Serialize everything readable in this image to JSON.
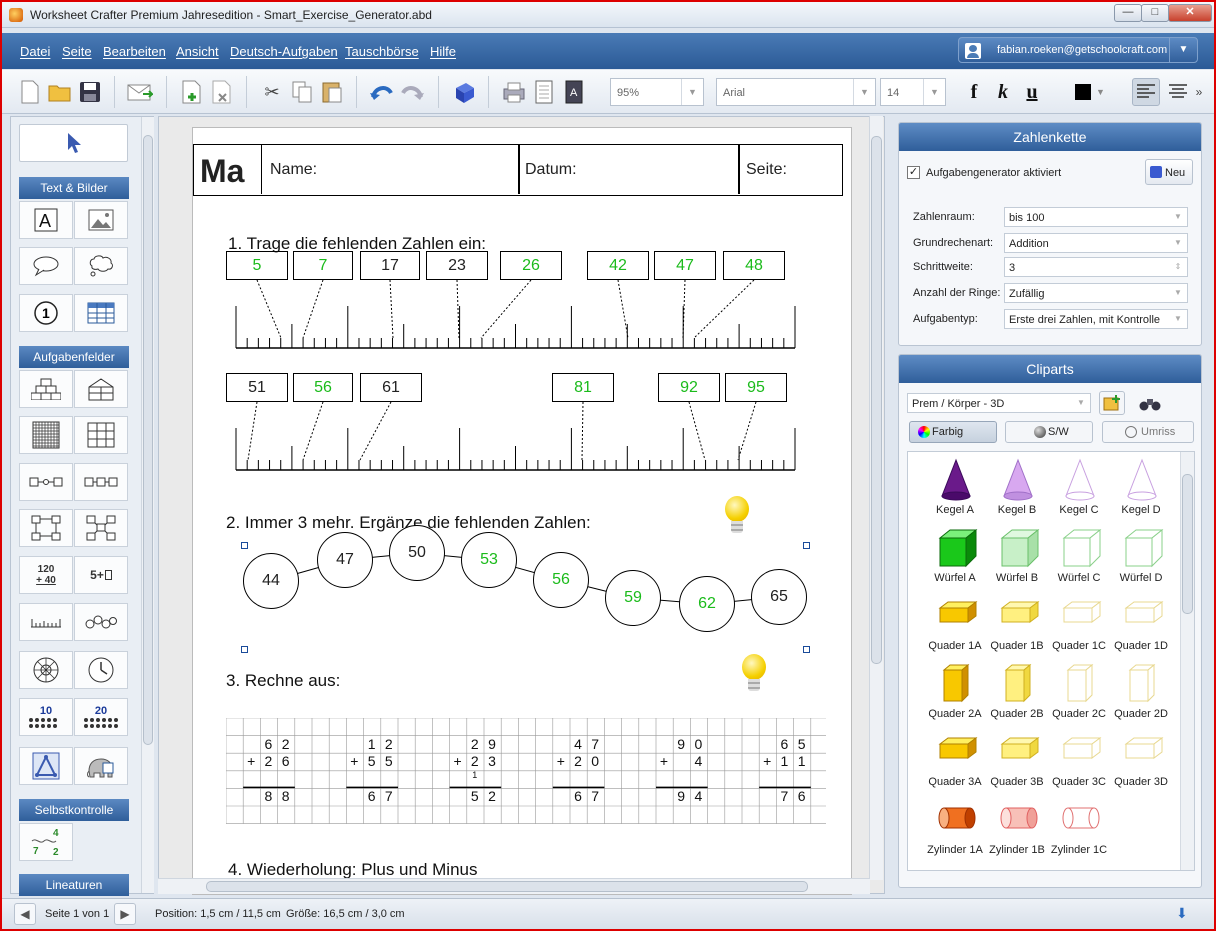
{
  "window": {
    "title": "Worksheet Crafter Premium Jahresedition - Smart_Exercise_Generator.abd"
  },
  "menu": {
    "items": [
      "Datei",
      "Seite",
      "Bearbeiten",
      "Ansicht",
      "Deutsch-Aufgaben",
      "Tauschbörse",
      "Hilfe"
    ],
    "user": "fabian.roeken@getschoolcraft.com"
  },
  "toolbar": {
    "zoom": "95%",
    "font": "Arial",
    "size": "14",
    "bold": "f",
    "italic": "k",
    "underline": "u"
  },
  "left": {
    "sections": [
      "Text & Bilder",
      "Aufgabenfelder",
      "Selbstkontrolle",
      "Lineaturen"
    ],
    "calc_icon_top": "120",
    "calc_icon_bottom": "+ 40",
    "calc_icon2": "5+",
    "dot_ten": "10",
    "dot_twenty": "20",
    "selfcheck_nums": [
      "4",
      "7",
      "2"
    ],
    "circle_one": "1"
  },
  "worksheet": {
    "subject": "Ma",
    "name_label": "Name:",
    "date_label": "Datum:",
    "page_label": "Seite:",
    "task1": "1. Trage die fehlenden Zahlen ein:",
    "row1": [
      {
        "v": "5",
        "g": true
      },
      {
        "v": "7",
        "g": true
      },
      {
        "v": "17",
        "g": false
      },
      {
        "v": "23",
        "g": false
      },
      {
        "v": "26",
        "g": true
      },
      {
        "v": "42",
        "g": true
      },
      {
        "v": "47",
        "g": true
      },
      {
        "v": "48",
        "g": true
      }
    ],
    "row2": [
      {
        "v": "51",
        "g": false
      },
      {
        "v": "56",
        "g": true
      },
      {
        "v": "61",
        "g": false
      },
      {
        "v": "81",
        "g": true
      },
      {
        "v": "92",
        "g": true
      },
      {
        "v": "95",
        "g": true
      }
    ],
    "task2": "2. Immer 3 mehr. Ergänze die fehlenden Zahlen:",
    "chain": [
      {
        "v": "44",
        "g": false
      },
      {
        "v": "47",
        "g": false
      },
      {
        "v": "50",
        "g": false
      },
      {
        "v": "53",
        "g": true
      },
      {
        "v": "56",
        "g": true
      },
      {
        "v": "59",
        "g": true
      },
      {
        "v": "62",
        "g": true
      },
      {
        "v": "65",
        "g": false
      }
    ],
    "task3": "3. Rechne aus:",
    "sums": [
      {
        "a": [
          "6",
          "2"
        ],
        "b": [
          "2",
          "6"
        ],
        "carry": "",
        "r": [
          "8",
          "8"
        ]
      },
      {
        "a": [
          "1",
          "2"
        ],
        "b": [
          "5",
          "5"
        ],
        "carry": "",
        "r": [
          "6",
          "7"
        ]
      },
      {
        "a": [
          "2",
          "9"
        ],
        "b": [
          "2",
          "3"
        ],
        "carry": "1",
        "r": [
          "5",
          "2"
        ]
      },
      {
        "a": [
          "4",
          "7"
        ],
        "b": [
          "2",
          "0"
        ],
        "carry": "",
        "r": [
          "6",
          "7"
        ]
      },
      {
        "a": [
          "9",
          "0"
        ],
        "b": [
          "",
          "4"
        ],
        "carry": "",
        "r": [
          "9",
          "4"
        ]
      },
      {
        "a": [
          "6",
          "5"
        ],
        "b": [
          "1",
          "1"
        ],
        "carry": "",
        "r": [
          "7",
          "6"
        ]
      }
    ],
    "plus": "+",
    "task4": "4. Wiederholung: Plus und Minus"
  },
  "zahlenkette": {
    "title": "Zahlenkette",
    "generator": "Aufgabengenerator aktiviert",
    "neu": "Neu",
    "fields": [
      {
        "label": "Zahlenraum:",
        "value": "bis 100"
      },
      {
        "label": "Grundrechenart:",
        "value": "Addition"
      },
      {
        "label": "Schrittweite:",
        "value": "3"
      },
      {
        "label": "Anzahl der Ringe:",
        "value": "Zufällig"
      },
      {
        "label": "Aufgabentyp:",
        "value": "Erste drei Zahlen, mit Kontrolle"
      }
    ]
  },
  "cliparts": {
    "title": "Cliparts",
    "category": "Prem / Körper - 3D",
    "tabs": [
      "Farbig",
      "S/W",
      "Umriss"
    ],
    "items": [
      [
        "Kegel A",
        "Kegel B",
        "Kegel C",
        "Kegel D"
      ],
      [
        "Würfel A",
        "Würfel B",
        "Würfel C",
        "Würfel D"
      ],
      [
        "Quader 1A",
        "Quader 1B",
        "Quader 1C",
        "Quader 1D"
      ],
      [
        "Quader 2A",
        "Quader 2B",
        "Quader 2C",
        "Quader 2D"
      ],
      [
        "Quader 3A",
        "Quader 3B",
        "Quader 3C",
        "Quader 3D"
      ],
      [
        "Zylinder 1A",
        "Zylinder 1B",
        "Zylinder 1C"
      ]
    ]
  },
  "status": {
    "page": "Seite 1 von 1",
    "position": "Position: 1,5 cm / 11,5 cm",
    "size": "Größe: 16,5 cm / 3,0 cm"
  }
}
